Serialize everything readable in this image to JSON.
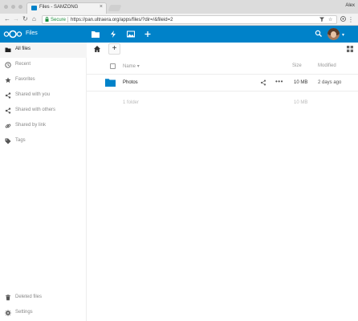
{
  "browser": {
    "tab_title": "Files - SAMZONG",
    "tab_close": "×",
    "user_name": "Alex",
    "secure_label": "Secure",
    "url": "https://pan.ultraera.org/apps/files/?dir=/&fileid=2",
    "back": "←",
    "forward": "→",
    "reload": "↻",
    "home": "⌂",
    "menu": "⋮"
  },
  "header": {
    "app_name": "Files",
    "brand_color": "#0082c9",
    "apps": [
      "files-icon",
      "activity-icon",
      "gallery-icon",
      "add-app-icon"
    ]
  },
  "sidebar": {
    "items": [
      {
        "label": "All files",
        "icon": "folder-icon",
        "active": true
      },
      {
        "label": "Recent",
        "icon": "clock-icon"
      },
      {
        "label": "Favorites",
        "icon": "star-icon"
      },
      {
        "label": "Shared with you",
        "icon": "share-icon"
      },
      {
        "label": "Shared with others",
        "icon": "share-icon"
      },
      {
        "label": "Shared by link",
        "icon": "link-icon"
      },
      {
        "label": "Tags",
        "icon": "tag-icon"
      }
    ],
    "bottom": [
      {
        "label": "Deleted files",
        "icon": "trash-icon"
      },
      {
        "label": "Settings",
        "icon": "gear-icon"
      }
    ]
  },
  "main": {
    "add_label": "+",
    "columns": {
      "name": "Name",
      "sort_indicator": "▾",
      "size": "Size",
      "modified": "Modified"
    },
    "files": [
      {
        "name": "Photos",
        "size": "10 MB",
        "modified": "2 days ago",
        "type": "folder"
      }
    ],
    "summary": {
      "count": "1 folder",
      "size": "10 MB"
    },
    "more_label": "•••"
  }
}
